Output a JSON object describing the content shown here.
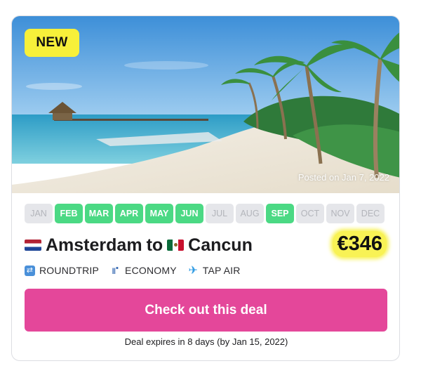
{
  "deal": {
    "badge": "NEW",
    "posted": "Posted on Jan 7, 2022",
    "months": [
      {
        "label": "JAN",
        "active": false
      },
      {
        "label": "FEB",
        "active": true
      },
      {
        "label": "MAR",
        "active": true
      },
      {
        "label": "APR",
        "active": true
      },
      {
        "label": "MAY",
        "active": true
      },
      {
        "label": "JUN",
        "active": true
      },
      {
        "label": "JUL",
        "active": false
      },
      {
        "label": "AUG",
        "active": false
      },
      {
        "label": "SEP",
        "active": true
      },
      {
        "label": "OCT",
        "active": false
      },
      {
        "label": "NOV",
        "active": false
      },
      {
        "label": "DEC",
        "active": false
      }
    ],
    "origin": "Amsterdam",
    "connector": "to",
    "destination": "Cancun",
    "price": "€346",
    "features": {
      "trip": "ROUNDTRIP",
      "cabin": "ECONOMY",
      "airline": "TAP AIR"
    },
    "cta": "Check out this deal",
    "expires": "Deal expires in 8 days (by Jan 15, 2022)"
  },
  "colors": {
    "badge": "#f7f03a",
    "month_active": "#4bd984",
    "month_inactive": "#e5e6ea",
    "price_highlight": "#f8f255",
    "cta": "#e4479a"
  },
  "icons": {
    "trip": "roundtrip-icon",
    "cabin": "seat-icon",
    "airline": "airplane-icon"
  }
}
